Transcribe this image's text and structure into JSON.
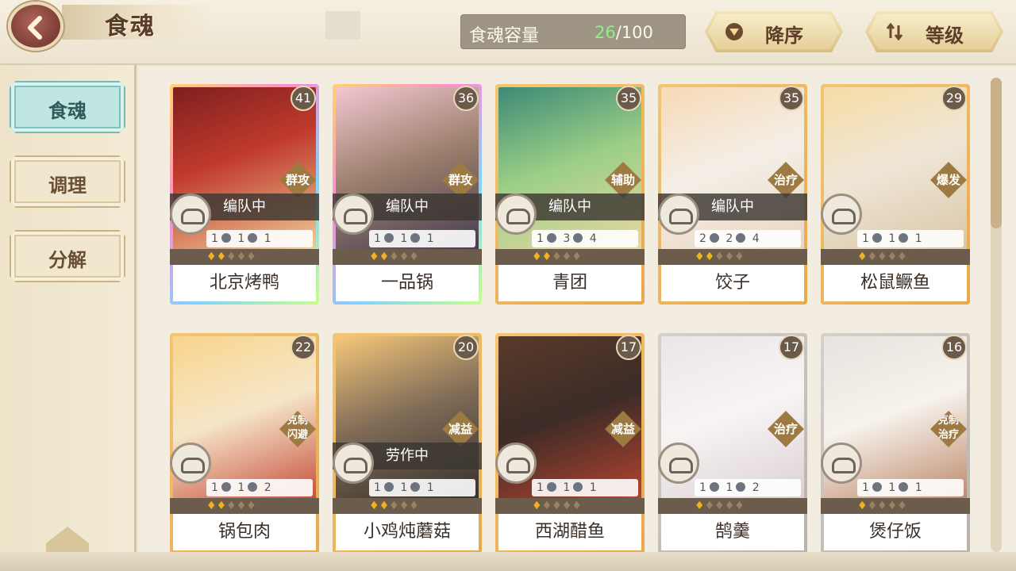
{
  "header": {
    "title": "食魂",
    "capacity_label": "食魂容量",
    "capacity_current": "26",
    "capacity_max": "/100",
    "sort_order_label": "降序",
    "sort_key_label": "等级"
  },
  "sidebar": {
    "items": [
      {
        "label": "食魂",
        "active": true
      },
      {
        "label": "调理",
        "active": false
      },
      {
        "label": "分解",
        "active": false
      }
    ]
  },
  "cards": [
    {
      "name": "北京烤鸭",
      "level": "41",
      "role": "群攻",
      "status": "编队中",
      "s1": "1",
      "s2": "1",
      "s3": "1",
      "flames": 2,
      "bg": "linear-gradient(160deg,#7e1f1f,#c03a2c 40%,#f5dca4)",
      "border": "linear-gradient(135deg,#ffd36b,#ff8bd3,#7fd3ff,#c6ff8b)"
    },
    {
      "name": "一品锅",
      "level": "36",
      "role": "群攻",
      "status": "编队中",
      "s1": "1",
      "s2": "1",
      "s3": "1",
      "flames": 2,
      "bg": "linear-gradient(160deg,#f3c7d2,#9c7f6c 45%,#3b3550)",
      "border": "linear-gradient(135deg,#ffd36b,#ff8bd3,#7fd3ff,#c6ff8b)"
    },
    {
      "name": "青团",
      "level": "35",
      "role": "辅助",
      "status": "编队中",
      "s1": "1",
      "s2": "3",
      "s3": "4",
      "flames": 2,
      "bg": "linear-gradient(160deg,#3d8a76,#9ccf86 45%,#f1d7a8)",
      "border": "linear-gradient(135deg,#f3c572,#e9a94a)"
    },
    {
      "name": "饺子",
      "level": "35",
      "role": "治疗",
      "status": "编队中",
      "s1": "2",
      "s2": "2",
      "s3": "4",
      "flames": 2,
      "bg": "linear-gradient(160deg,#f7d9b6,#f4efe7 45%,#e8d2bb)",
      "border": "linear-gradient(135deg,#f3c572,#e9a94a)"
    },
    {
      "name": "松鼠鳜鱼",
      "level": "29",
      "role": "爆发",
      "status": "",
      "s1": "1",
      "s2": "1",
      "s3": "1",
      "flames": 1,
      "bg": "linear-gradient(160deg,#f6dca4,#efe6d7 45%,#d7c2a0)",
      "border": "linear-gradient(135deg,#f3c572,#e9a94a)"
    },
    {
      "name": "锅包肉",
      "level": "22",
      "role": "克制\n闪避",
      "status": "",
      "s1": "1",
      "s2": "1",
      "s3": "2",
      "flames": 2,
      "bg": "linear-gradient(160deg,#f8d58d,#f6e6c8 45%,#c03a2c)",
      "border": "linear-gradient(135deg,#f3c572,#e9a94a)"
    },
    {
      "name": "小鸡炖蘑菇",
      "level": "20",
      "role": "减益",
      "status": "劳作中",
      "s1": "1",
      "s2": "1",
      "s3": "1",
      "flames": 2,
      "bg": "linear-gradient(160deg,#f5c77a,#7f6b57 45%,#2f2a28)",
      "border": "linear-gradient(135deg,#f3c572,#e9a94a)"
    },
    {
      "name": "西湖醋鱼",
      "level": "17",
      "role": "减益",
      "status": "",
      "s1": "1",
      "s2": "1",
      "s3": "1",
      "flames": 1,
      "bg": "linear-gradient(160deg,#5a3b2a,#3c2b27 45%,#c4472f)",
      "border": "linear-gradient(135deg,#f3c572,#e9a94a)"
    },
    {
      "name": "鹄羹",
      "level": "17",
      "role": "治疗",
      "status": "",
      "s1": "1",
      "s2": "1",
      "s3": "2",
      "flames": 1,
      "bg": "linear-gradient(160deg,#e9e6e9,#f8f4f4 45%,#d8ccd0)",
      "border": "linear-gradient(135deg,#d4d0cc,#b8b2ab)"
    },
    {
      "name": "煲仔饭",
      "level": "16",
      "role": "克制\n治疗",
      "status": "",
      "s1": "1",
      "s2": "1",
      "s3": "1",
      "flames": 1,
      "bg": "linear-gradient(160deg,#e7e3de,#f6f2ec 45%,#b87c5a)",
      "border": "linear-gradient(135deg,#d4d0cc,#b8b2ab)"
    }
  ]
}
